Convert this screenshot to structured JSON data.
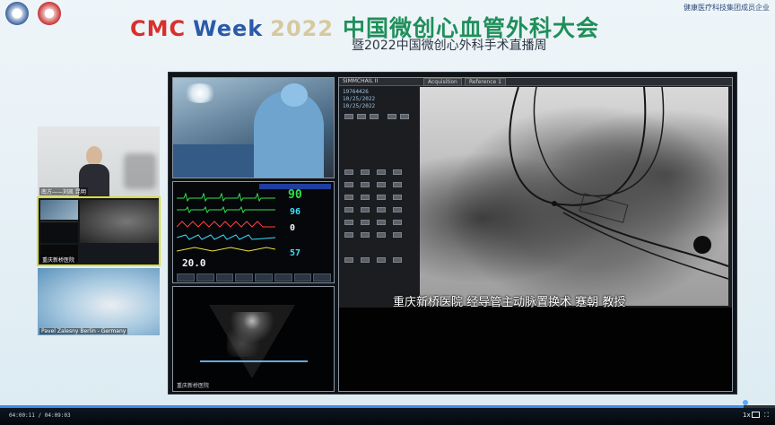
{
  "header": {
    "cmc": "CMC",
    "week": "Week",
    "year": "2022",
    "title_cn": "中国微创心血管外科大会",
    "subtitle": "暨2022中国微创心外科手术直播周",
    "sponsor_org": "健康医疗科技集团成员企业"
  },
  "tiles": [
    {
      "label": "南方——刘凯 昆明"
    },
    {
      "label": "重庆新桥医院"
    },
    {
      "label": "Pavel Zalesny  Berlin - Germany"
    }
  ],
  "monitor": {
    "hr": "90",
    "spo2": "96",
    "pa": "0",
    "resp": "57",
    "temp": "20.0",
    "colors": {
      "green": "#33e04a",
      "cyan": "#3de0ff",
      "yellow": "#f2e23a",
      "white": "#f5f5f5",
      "red": "#ff4040"
    }
  },
  "cath": {
    "system_name": "SIMMCHAIL II",
    "tabs": [
      "Acquisition",
      "Reference 1"
    ],
    "info_lines": [
      "19764426",
      "10/25/2022",
      "10/25/2022"
    ],
    "caption": "重庆新桥医院   经导管主动脉置换术   蹇朝  教授"
  },
  "echo": {
    "label": "重庆新桥医院"
  },
  "player": {
    "time": "04:00:11 / 04:09:03",
    "progress": 0.96,
    "speed": "1x",
    "accent": "#3a8ee6"
  }
}
